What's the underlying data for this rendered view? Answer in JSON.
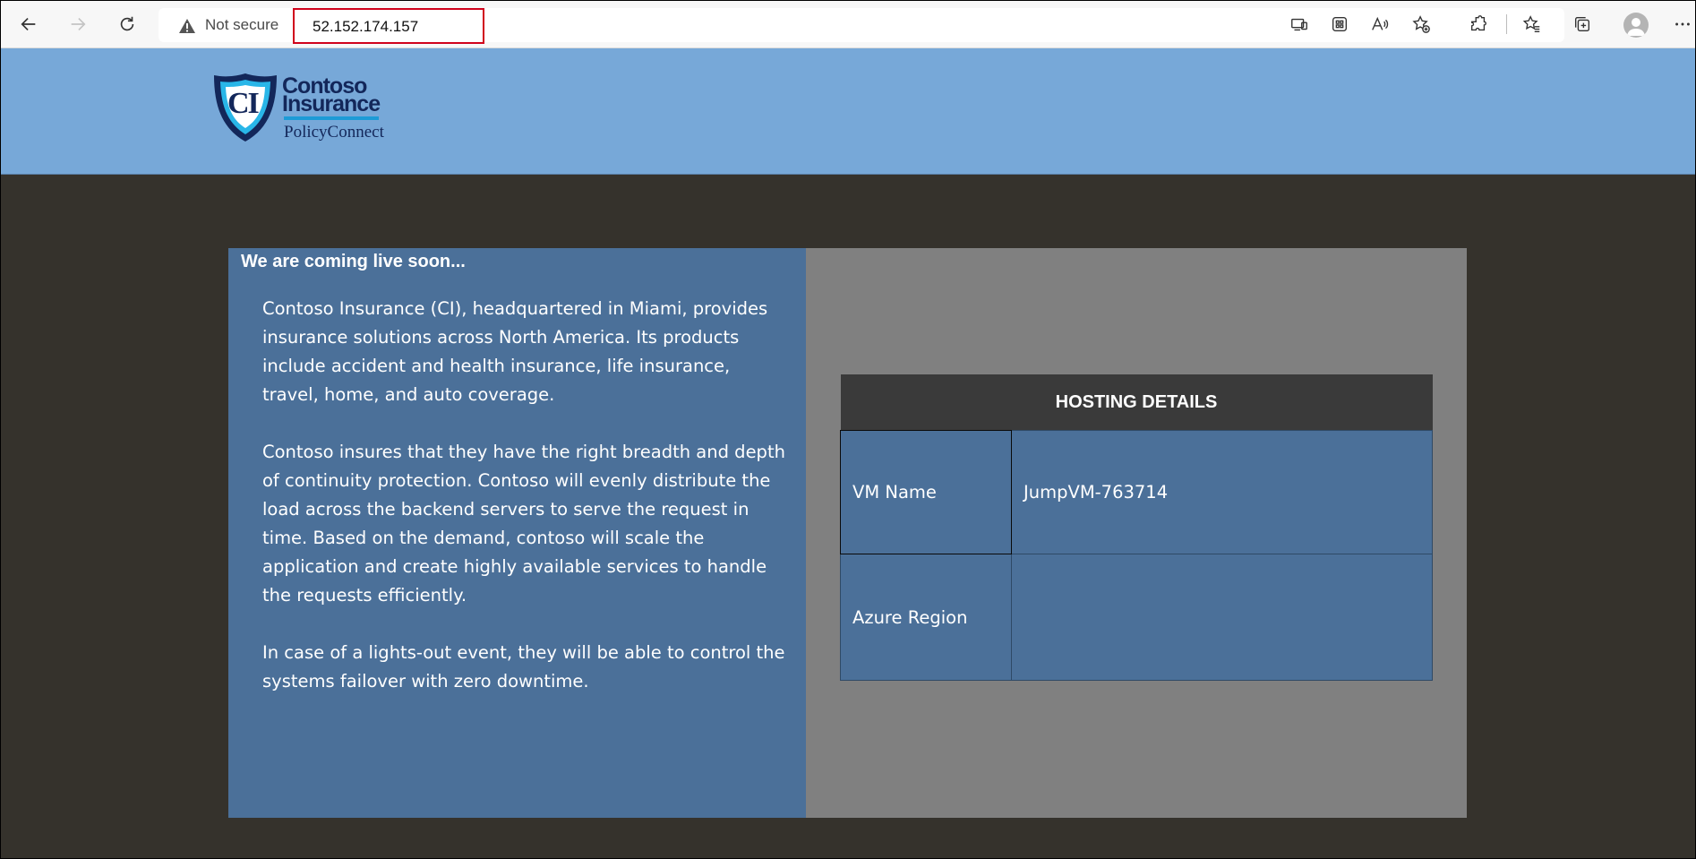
{
  "browser": {
    "security_label": "Not secure",
    "url": "52.152.174.157",
    "icons": [
      "back-icon",
      "forward-icon",
      "refresh-icon",
      "warning-icon",
      "cast-icon",
      "apps-icon",
      "read-aloud-icon",
      "add-favorite-icon",
      "extensions-icon",
      "favorites-icon",
      "collections-icon",
      "profile-icon",
      "more-icon"
    ],
    "highlight_color": "#d0021b"
  },
  "header": {
    "logo": {
      "monogram": "CI",
      "name_line1": "Contoso",
      "name_line2": "Insurance",
      "tagline": "PolicyConnect"
    },
    "background_color": "#77a8d8"
  },
  "main": {
    "title": "We are coming live soon...",
    "paragraphs": [
      "Contoso Insurance (CI), headquartered in Miami, provides insurance solutions across North America. Its products include accident and health insurance, life insurance, travel, home, and auto coverage.",
      "Contoso insures that they have the right breadth and depth of continuity protection. Contoso will evenly distribute the load across the backend servers to serve the request in time. Based on the demand, contoso will scale the application and create highly available services to handle the requests efficiently.",
      "In case of a lights-out event, they will be able to control the systems failover with zero downtime."
    ],
    "hosting": {
      "header": "HOSTING DETAILS",
      "rows": [
        {
          "label": "VM Name",
          "value": "JumpVM-763714"
        },
        {
          "label": "Azure Region",
          "value": ""
        }
      ]
    },
    "colors": {
      "page_bg": "#35322c",
      "panel_blue": "#4b7099",
      "panel_gray": "#808080",
      "table_header": "#3a3a3a"
    }
  }
}
